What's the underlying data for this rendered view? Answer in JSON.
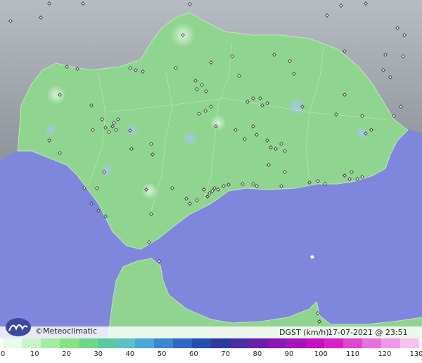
{
  "brand": {
    "logo": "meteoclimatic-logo",
    "name": "©Meteoclimatic"
  },
  "map_info": {
    "variable": "DGST (km/h)",
    "timestamp": "17-07-2021 @ 23:51 UTC"
  },
  "scale": {
    "unit": "km/h",
    "ticks": [
      "0",
      "10",
      "20",
      "30",
      "40",
      "50",
      "60",
      "70",
      "80",
      "90",
      "100",
      "110",
      "120",
      "130"
    ],
    "colors": [
      "#e8fce8",
      "#c8f4c8",
      "#a4eca4",
      "#84e484",
      "#6ed88a",
      "#5ccaa0",
      "#5cc0c4",
      "#4aa6d8",
      "#3a86d0",
      "#2c68c4",
      "#2650b0",
      "#2a3a9e",
      "#4a2ea4",
      "#6a20aa",
      "#8a18b2",
      "#a812b8",
      "#c410c0",
      "#d820c8",
      "#e044d2",
      "#e870dc",
      "#f098e6",
      "#f8c2f0"
    ]
  },
  "colors": {
    "sea": "#7f87dc",
    "land": "#8fd48f",
    "foreign_land": "#9aa0a6"
  },
  "stations_marker": "station-diamond"
}
